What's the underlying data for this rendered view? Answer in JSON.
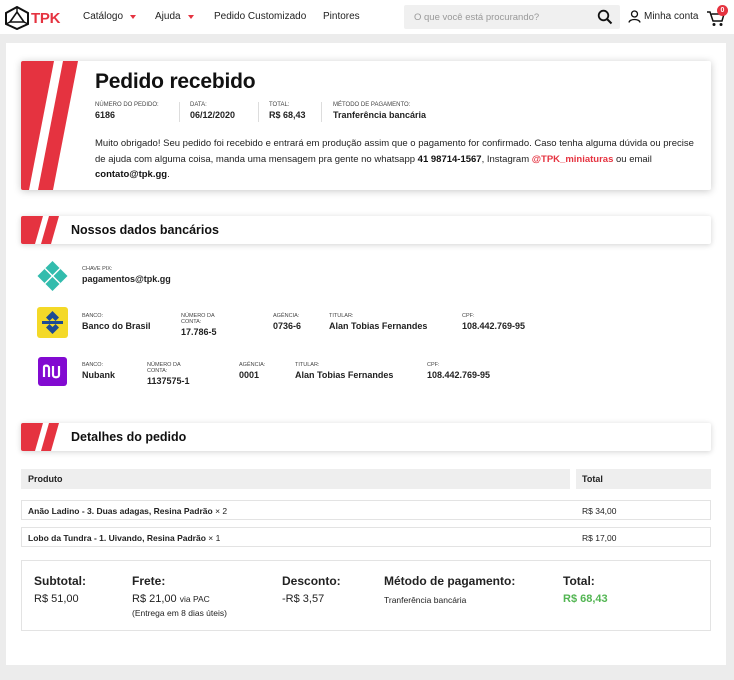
{
  "nav": {
    "brand": "TPK",
    "links": [
      {
        "label": "Catálogo"
      },
      {
        "label": "Ajuda"
      },
      {
        "label": "Pedido Customizado"
      },
      {
        "label": "Pintores"
      }
    ],
    "search_placeholder": "O que você está procurando?",
    "account_label": "Minha conta",
    "cart_count": "0"
  },
  "order": {
    "title": "Pedido recebido",
    "meta": [
      {
        "label": "NÚMERO DO PEDIDO:",
        "value": "6186"
      },
      {
        "label": "DATA:",
        "value": "06/12/2020"
      },
      {
        "label": "TOTAL:",
        "value": "R$ 68,43"
      },
      {
        "label": "MÉTODO DE PAGAMENTO:",
        "value": "Tranferência bancária"
      }
    ],
    "message_part1": "Muito obrigado! Seu pedido foi recebido e entrará em produção assim que o pagamento for confirmado. Caso tenha alguma dúvida ou precise de ajuda com alguma coisa, manda uma mensagem pra gente no whatsapp ",
    "whatsapp": "41 98714-1567",
    "message_part2": ", Instagram ",
    "instagram": "@TPK_miniaturas",
    "message_part3": " ou email ",
    "email": "contato@tpk.gg",
    "message_part4": "."
  },
  "bank": {
    "heading": "Nossos dados bancários",
    "pix": {
      "label": "CHAVE PIX:",
      "value": "pagamentos@tpk.gg"
    },
    "bb": [
      {
        "label": "BANCO:",
        "value": "Banco do Brasil"
      },
      {
        "label": "NÚMERO DA CONTA:",
        "value": "17.786-5"
      },
      {
        "label": "AGÊNCIA:",
        "value": "0736-6"
      },
      {
        "label": "TITULAR:",
        "value": "Alan Tobias Fernandes"
      },
      {
        "label": "CPF:",
        "value": "108.442.769-95"
      }
    ],
    "nubank": [
      {
        "label": "BANCO:",
        "value": "Nubank"
      },
      {
        "label": "NÚMERO DA CONTA:",
        "value": "1137575-1"
      },
      {
        "label": "AGÊNCIA:",
        "value": "0001"
      },
      {
        "label": "TITULAR:",
        "value": "Alan Tobias Fernandes"
      },
      {
        "label": "CPF:",
        "value": "108.442.769-95"
      }
    ]
  },
  "details": {
    "heading": "Detalhes do pedido",
    "col_product": "Produto",
    "col_total": "Total",
    "items": [
      {
        "name": "Anão Ladino - 3. Duas adagas, Resina Padrão",
        "qty": "× 2",
        "total": "R$ 34,00"
      },
      {
        "name": "Lobo da Tundra - 1. Uivando, Resina Padrão",
        "qty": "× 1",
        "total": "R$ 17,00"
      }
    ],
    "summary": {
      "subtotal_label": "Subtotal:",
      "subtotal": "R$ 51,00",
      "shipping_label": "Frete:",
      "shipping": "R$ 21,00",
      "shipping_via": "via PAC",
      "shipping_note": "(Entrega em 8 dias úteis)",
      "discount_label": "Desconto:",
      "discount": "-R$ 3,57",
      "method_label": "Método de pagamento:",
      "method": "Tranferência bancária",
      "total_label": "Total:",
      "total": "R$ 68,43"
    }
  },
  "colors": {
    "accent": "#e53340",
    "total_green": "#52b552"
  }
}
